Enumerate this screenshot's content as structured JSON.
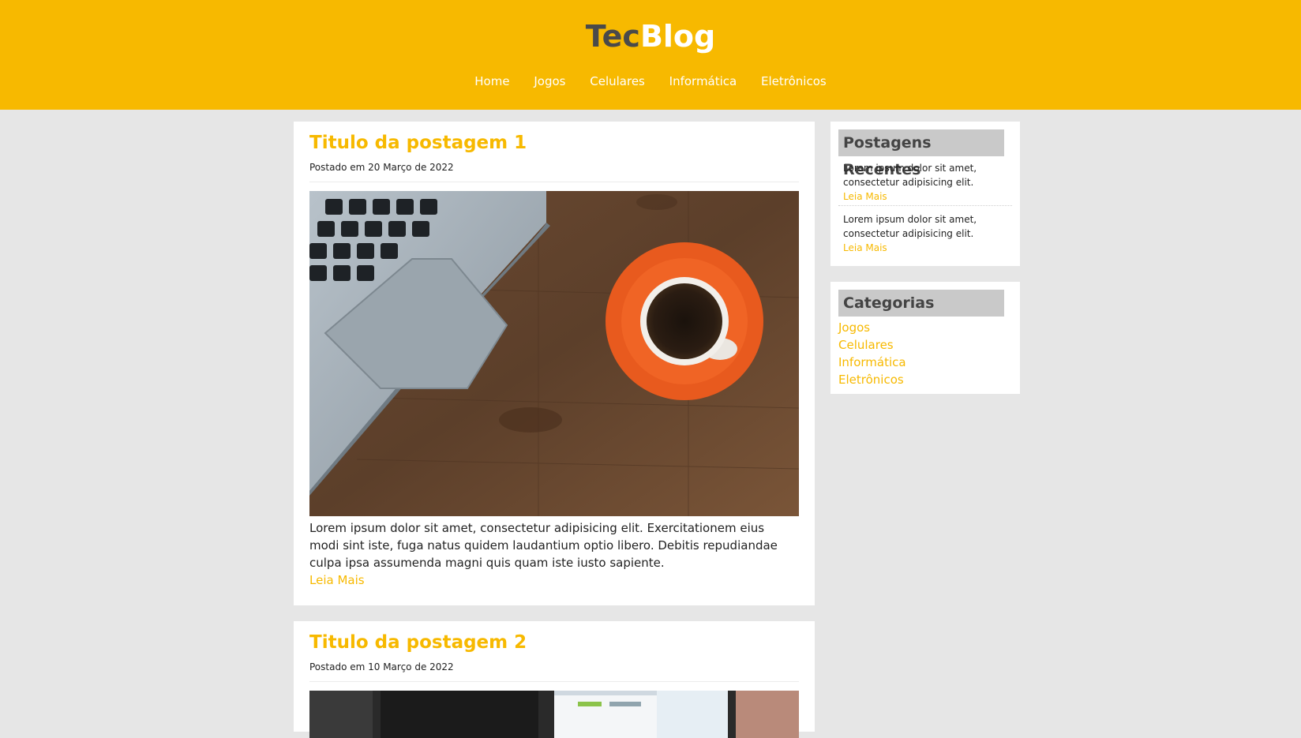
{
  "header": {
    "logo": {
      "part1": "Tec",
      "part2": "Blog"
    },
    "nav": [
      "Home",
      "Jogos",
      "Celulares",
      "Informática",
      "Eletrônicos"
    ]
  },
  "posts": [
    {
      "title": "Titulo da postagem 1",
      "date": "Postado em 20 Março de 2022",
      "text": "Lorem ipsum dolor sit amet, consectetur adipisicing elit. Exercitationem eius modi sint iste, fuga natus quidem laudantium optio libero. Debitis repudiandae culpa ipsa assumenda magni quis quam iste iusto sapiente.",
      "read_more": "Leia Mais"
    },
    {
      "title": "Titulo da postagem 2",
      "date": "Postado em 10 Março de 2022"
    }
  ],
  "sidebar": {
    "recent": {
      "title": "Postagens Recentes",
      "items": [
        {
          "text": "Lorem ipsum dolor sit amet, consectetur adipisicing elit.",
          "read_more": "Leia Mais"
        },
        {
          "text": "Lorem ipsum dolor sit amet, consectetur adipisicing elit.",
          "read_more": "Leia Mais"
        }
      ]
    },
    "categories": {
      "title": "Categorias",
      "items": [
        "Jogos",
        "Celulares",
        "Informática",
        "Eletrônicos"
      ]
    }
  },
  "colors": {
    "accent": "#f7b900",
    "background": "#e6e6e6",
    "widget_title_bg": "#c9c9c9"
  }
}
